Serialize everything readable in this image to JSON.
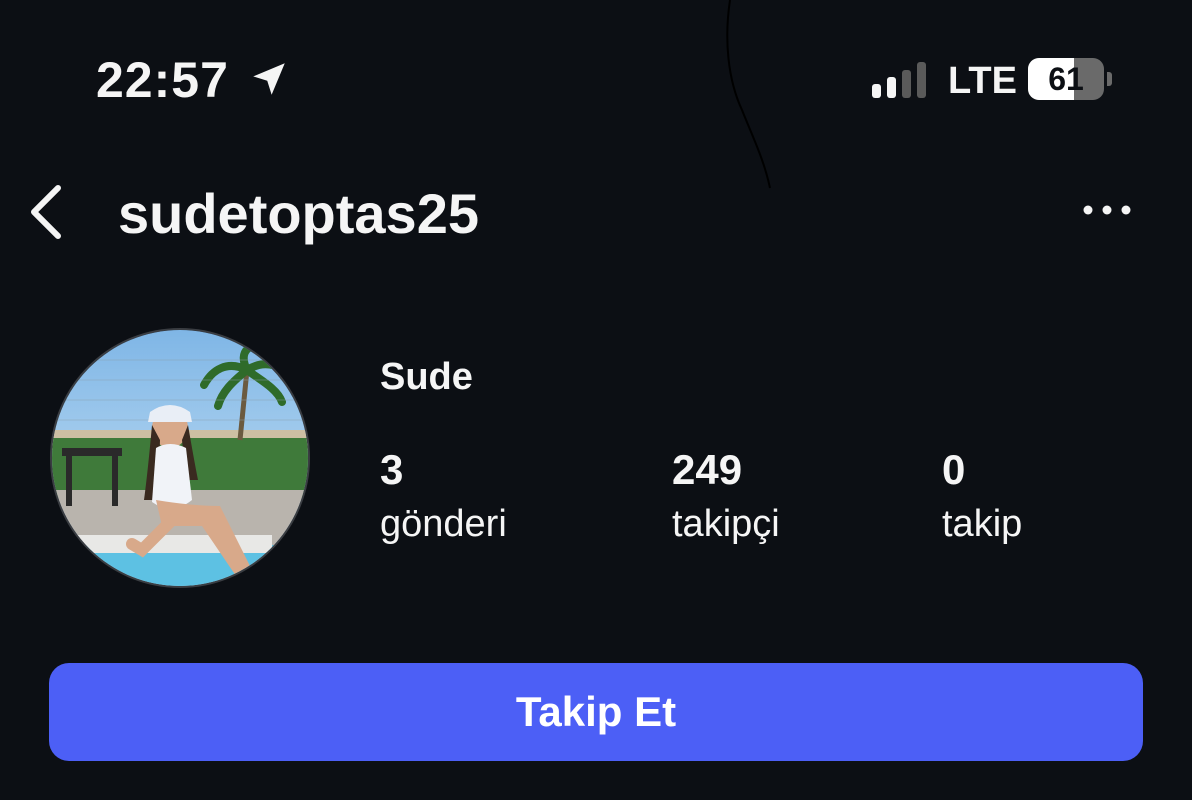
{
  "status_bar": {
    "time": "22:57",
    "network": "LTE",
    "battery_level": "61",
    "battery_fraction": 0.61,
    "icons": [
      "location-arrow-icon",
      "signal-icon",
      "battery-icon"
    ]
  },
  "header": {
    "username": "sudetoptas25",
    "back_icon": "chevron-left-icon",
    "more_icon": "more-horizontal-icon"
  },
  "profile": {
    "display_name": "Sude",
    "stats": [
      {
        "value": "3",
        "label": "gönderi"
      },
      {
        "value": "249",
        "label": "takipçi"
      },
      {
        "value": "0",
        "label": "takip"
      }
    ]
  },
  "actions": {
    "follow_label": "Takip Et"
  },
  "colors": {
    "background": "#0c0f14",
    "primary_button": "#4c5ff6",
    "text": "#f5f5f5"
  }
}
